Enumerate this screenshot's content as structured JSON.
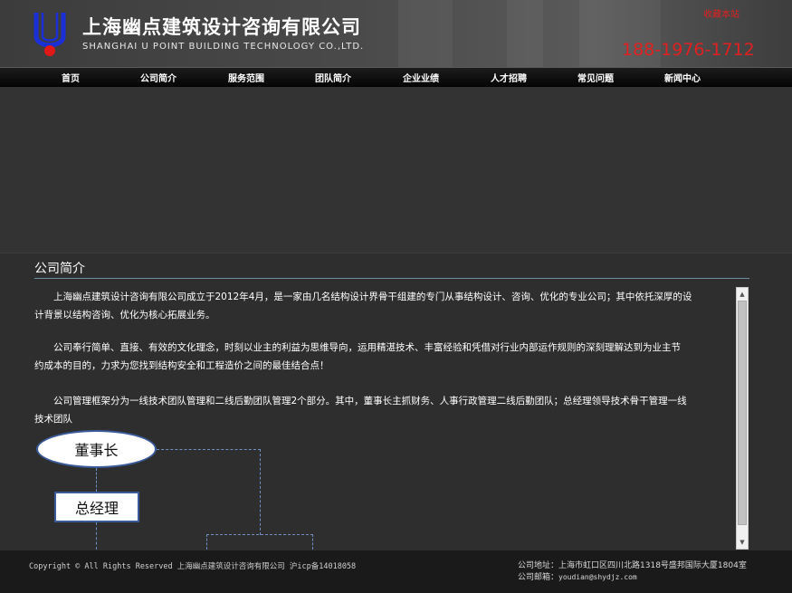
{
  "header": {
    "company_cn": "上海幽点建筑设计咨询有限公司",
    "company_en": "SHANGHAI U POINT BUILDING TECHNOLOGY CO.,LTD.",
    "bookmark": "收藏本站",
    "hotline": "188-1976-1712",
    "accent_color": "#e02020"
  },
  "nav": {
    "items": [
      {
        "label": "首页"
      },
      {
        "label": "公司简介"
      },
      {
        "label": "服务范围"
      },
      {
        "label": "团队简介"
      },
      {
        "label": "企业业绩"
      },
      {
        "label": "人才招聘"
      },
      {
        "label": "常见问题"
      },
      {
        "label": "新闻中心"
      }
    ]
  },
  "main": {
    "title": "公司简介",
    "paragraphs": [
      {
        "line1": "　　上海幽点建筑设计咨询有限公司成立于2012年4月，是一家由几名结构设计界骨干组建的专门从事结构设计、咨询、优化的专业公司；其中依托深厚的设",
        "line2": "计背景以结构咨询、优化为核心拓展业务。"
      },
      {
        "line1": "　　公司奉行简单、直接、有效的文化理念，时刻以业主的利益为思维导向，运用精湛技术、丰富经验和凭借对行业内部运作规则的深刻理解达到为业主节",
        "line2": "约成本的目的，力求为您找到结构安全和工程造价之间的最佳结合点！"
      },
      {
        "line1": "　　公司管理框架分为一线技术团队管理和二线后勤团队管理2个部分。其中，董事长主抓财务、人事行政管理二线后勤团队；总经理领导技术骨干管理一线",
        "line2": "技术团队"
      }
    ],
    "org_chart": {
      "chairman": "董事长",
      "general_manager": "总经理"
    }
  },
  "footer": {
    "copyright": "Copyright © All Rights Reserved 上海幽点建筑设计咨询有限公司 沪icp备14018058",
    "address_label": "公司地址：",
    "address": "上海市虹口区四川北路1318号盛邦国际大厦1804室",
    "email_label": "公司邮箱：",
    "email": "youdian@shydjz.com"
  }
}
